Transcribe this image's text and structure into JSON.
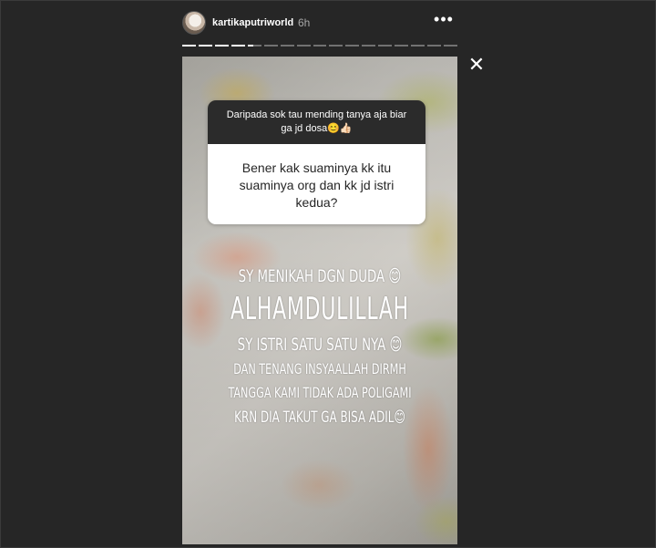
{
  "header": {
    "username": "kartikaputriworld",
    "time": "6h",
    "more_icon": "more-horizontal-icon"
  },
  "progress": {
    "segments": 17,
    "done": 3,
    "current_index": 4
  },
  "close_icon": "close-icon",
  "question": {
    "prompt": "Daripada sok tau mending tanya aja biar ga jd dosa😊👍🏻",
    "answer": "Bener kak suaminya kk itu suaminya org dan kk jd istri kedua?"
  },
  "overlay_text": {
    "line1": "SY MENIKAH DGN DUDA 😊",
    "line2": "ALHAMDULILLAH",
    "line3": "SY ISTRI SATU SATU NYA 😊",
    "line4": "DAN TENANG INSYAALLAH DIRMH",
    "line5": "TANGGA KAMI TIDAK ADA POLIGAMI",
    "line6": "KRN DIA TAKUT GA BISA ADIL😊"
  },
  "colors": {
    "background": "#262626",
    "question_header": "#2b2b2b",
    "question_body": "#ffffff"
  }
}
